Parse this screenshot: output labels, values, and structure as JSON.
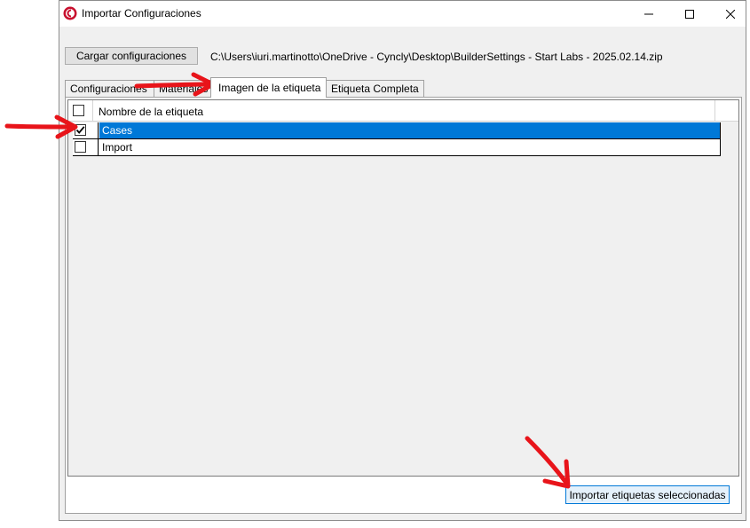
{
  "window": {
    "title": "Importar Configuraciones",
    "icons": {
      "app": "app-logo-icon",
      "minimize": "minimize-icon",
      "maximize": "maximize-icon",
      "close": "close-icon"
    }
  },
  "toolbar": {
    "load_label": "Cargar configuraciones",
    "file_path": "C:\\Users\\iuri.martinotto\\OneDrive - Cyncly\\Desktop\\BuilderSettings - Start Labs - 2025.02.14.zip"
  },
  "tabs": [
    {
      "label": "Configuraciones",
      "active": false
    },
    {
      "label": "Materiales",
      "active": false
    },
    {
      "label": "Imagen de la etiqueta",
      "active": true
    },
    {
      "label": "Etiqueta Completa",
      "active": false
    }
  ],
  "grid": {
    "header": {
      "name": "Nombre de la etiqueta",
      "checked": false
    },
    "rows": [
      {
        "name": "Cases",
        "checked": true,
        "selected": true
      },
      {
        "name": "Import",
        "checked": false,
        "selected": false
      }
    ]
  },
  "footer": {
    "import_label": "Importar etiquetas seleccionadas"
  },
  "annotations": {
    "color": "#e8141a",
    "icon": "red-arrow-icon"
  },
  "colors": {
    "selection": "#0078d7",
    "button_focus": "#e5f1fb"
  }
}
